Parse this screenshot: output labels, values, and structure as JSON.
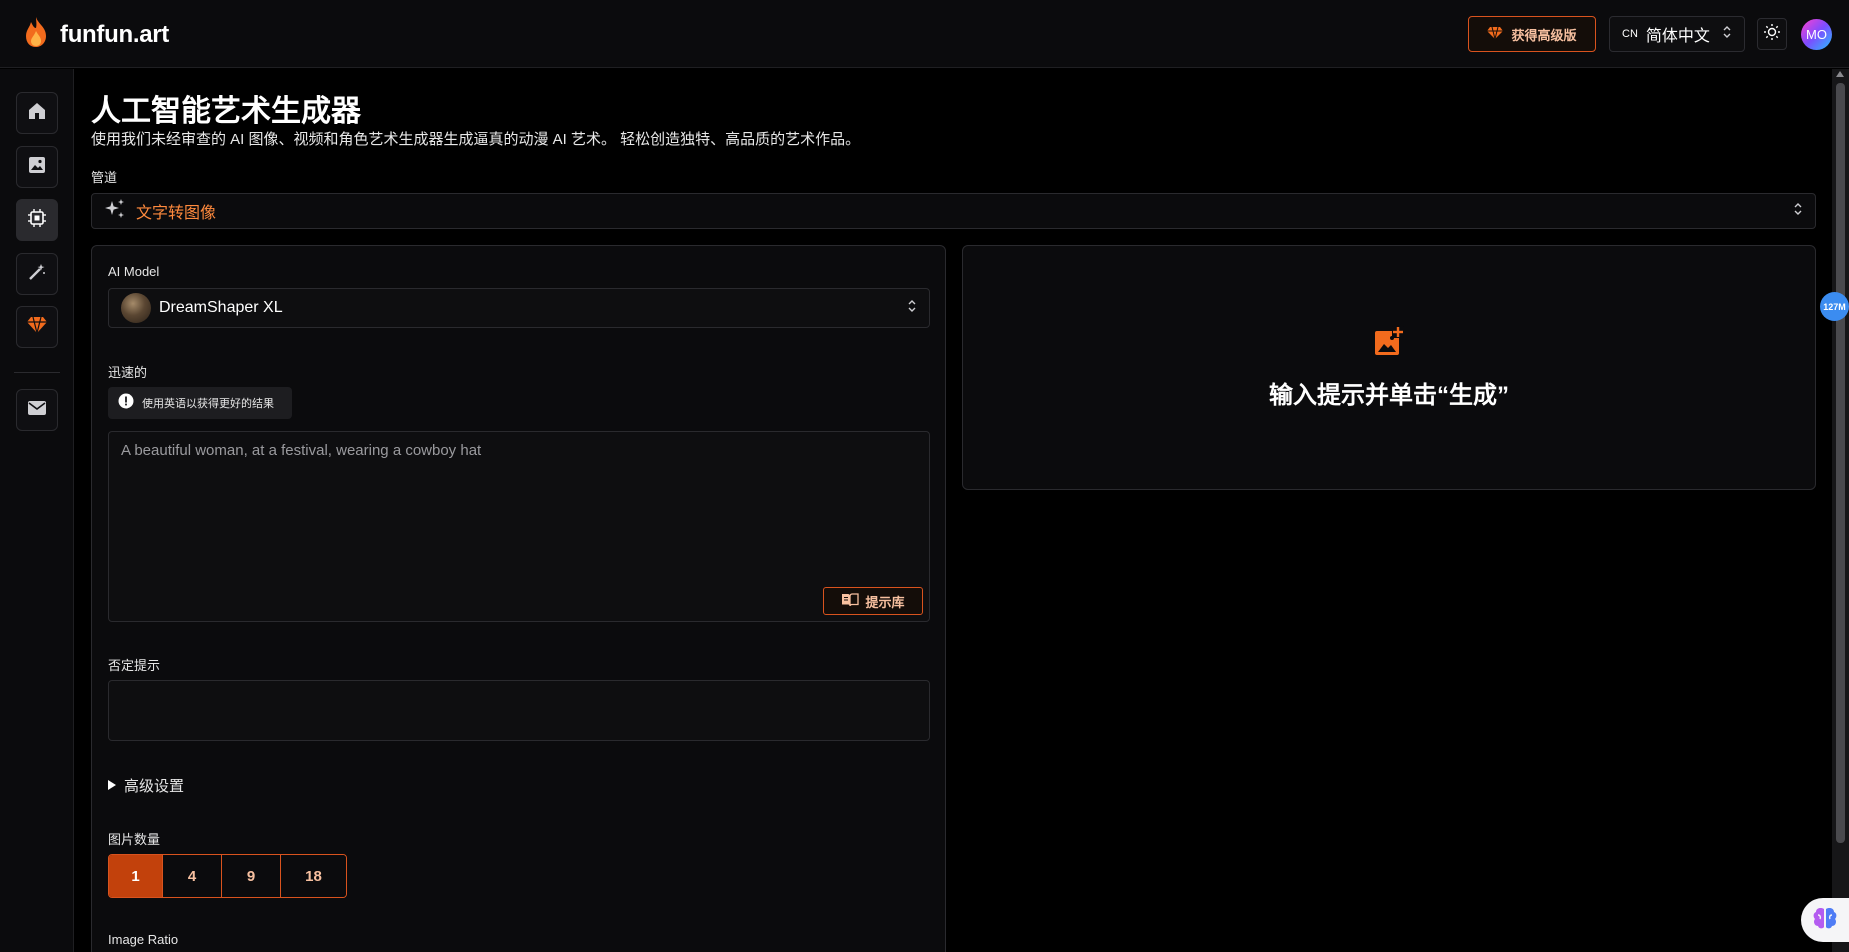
{
  "header": {
    "brand": "funfun.art",
    "premium_label": "获得高级版",
    "language_code": "CN",
    "language_label": "简体中文",
    "avatar_initials": "MO"
  },
  "sidebar": {
    "items": [
      {
        "name": "home",
        "icon": "home-icon",
        "active": false
      },
      {
        "name": "gallery",
        "icon": "image-icon",
        "active": false
      },
      {
        "name": "generator",
        "icon": "chip-icon",
        "active": true
      },
      {
        "name": "magic",
        "icon": "magic-wand-icon",
        "active": false
      },
      {
        "name": "premium",
        "icon": "gem-icon",
        "active": false
      },
      {
        "name": "mail",
        "icon": "mail-icon",
        "active": false
      }
    ]
  },
  "main": {
    "title": "人工智能艺术生成器",
    "subtitle": "使用我们未经审查的 AI 图像、视频和角色艺术生成器生成逼真的动漫 AI 艺术。 轻松创造独特、高品质的艺术作品。",
    "pipeline_label": "管道",
    "pipeline_value": "文字转图像",
    "model_label": "AI Model",
    "model_value": "DreamShaper XL",
    "prompt_label": "迅速的",
    "prompt_tip": "使用英语以获得更好的结果",
    "prompt_value": "A beautiful woman, at a festival, wearing a cowboy hat",
    "prompt_library_label": "提示库",
    "negative_label": "否定提示",
    "negative_value": "",
    "advanced_label": "高级设置",
    "count_label": "图片数量",
    "count_options": [
      "1",
      "4",
      "9",
      "18"
    ],
    "count_selected": "1",
    "ratio_label": "Image Ratio",
    "empty_state_text": "输入提示并单击“生成”"
  },
  "floating": {
    "memory_badge": "127M"
  },
  "colors": {
    "accent": "#d9531e",
    "accent_text": "#ff8a3d",
    "background": "#000000",
    "panel": "#0b0b0d"
  }
}
